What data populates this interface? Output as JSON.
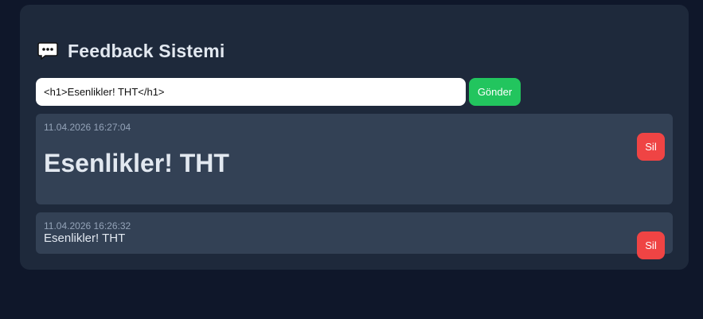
{
  "header": {
    "icon": "speech-bubble-icon",
    "title": "Feedback Sistemi"
  },
  "form": {
    "input_value": "<h1>Esenlikler! THT</h1>",
    "send_label": "Gönder"
  },
  "feedbacks": [
    {
      "timestamp": "11.04.2026 16:27:04",
      "content": "Esenlikler! THT",
      "delete_label": "Sil"
    },
    {
      "timestamp": "11.04.2026 16:26:32",
      "content": "Esenlikler! THT",
      "delete_label": "Sil"
    }
  ],
  "colors": {
    "page_background": "#0f172a",
    "panel_background": "#1e293b",
    "card_background": "#334155",
    "send_button": "#22c55e",
    "delete_button": "#ef4444"
  }
}
